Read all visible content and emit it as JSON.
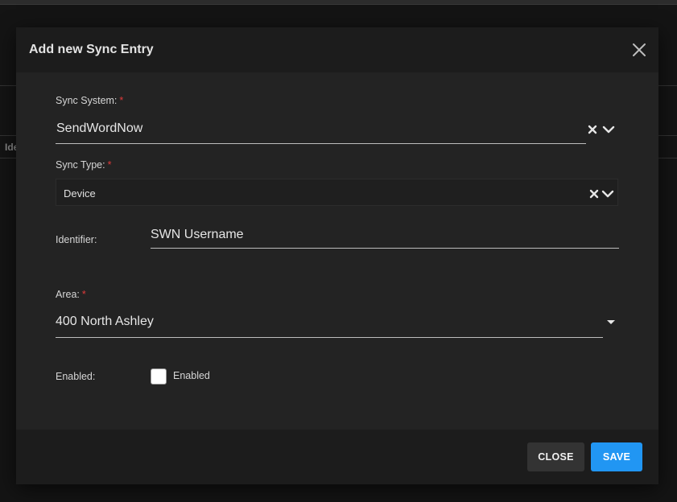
{
  "background": {
    "fragment_text": "Ide"
  },
  "dialog": {
    "title": "Add new Sync Entry",
    "close_icon": "close-icon",
    "fields": {
      "sync_system": {
        "label": "Sync System:",
        "required_mark": "*",
        "value": "SendWordNow"
      },
      "sync_type": {
        "label": "Sync Type:",
        "required_mark": "*",
        "value": "Device"
      },
      "identifier": {
        "label": "Identifier:",
        "value": "SWN Username"
      },
      "area": {
        "label": "Area:",
        "required_mark": "*",
        "value": "400 North Ashley"
      },
      "enabled": {
        "label": "Enabled:",
        "checkbox_label": "Enabled",
        "checked": false
      }
    },
    "footer": {
      "close_label": "CLOSE",
      "save_label": "SAVE"
    }
  },
  "colors": {
    "accent": "#2196f3",
    "required": "#e03a3a",
    "dialog_bg": "#232323",
    "header_bg": "#1c1c1c"
  }
}
